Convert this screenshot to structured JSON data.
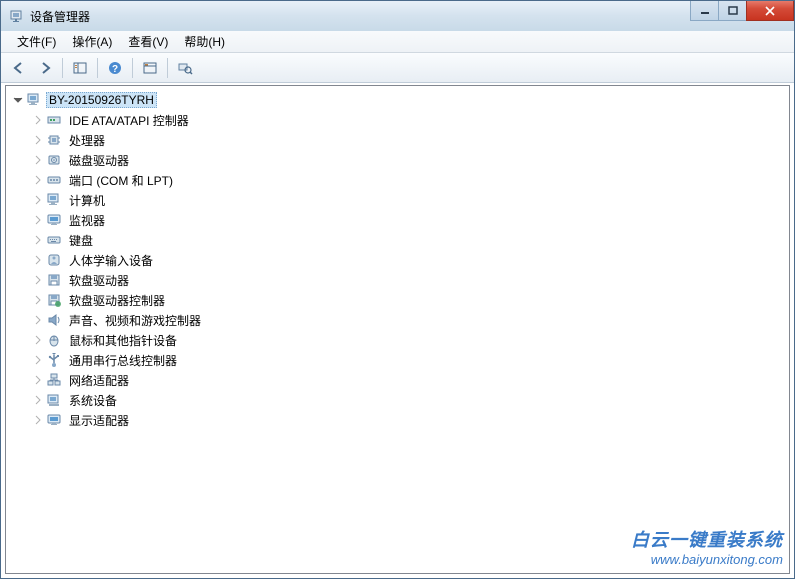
{
  "window": {
    "title": "设备管理器"
  },
  "menu": {
    "file": "文件(F)",
    "action": "操作(A)",
    "view": "查看(V)",
    "help": "帮助(H)"
  },
  "tree": {
    "root": "BY-20150926TYRH",
    "items": [
      {
        "label": "IDE ATA/ATAPI 控制器",
        "icon": "ide"
      },
      {
        "label": "处理器",
        "icon": "cpu"
      },
      {
        "label": "磁盘驱动器",
        "icon": "disk"
      },
      {
        "label": "端口 (COM 和 LPT)",
        "icon": "port"
      },
      {
        "label": "计算机",
        "icon": "computer"
      },
      {
        "label": "监视器",
        "icon": "monitor"
      },
      {
        "label": "键盘",
        "icon": "keyboard"
      },
      {
        "label": "人体学输入设备",
        "icon": "hid"
      },
      {
        "label": "软盘驱动器",
        "icon": "floppy"
      },
      {
        "label": "软盘驱动器控制器",
        "icon": "floppyctrl"
      },
      {
        "label": "声音、视频和游戏控制器",
        "icon": "sound"
      },
      {
        "label": "鼠标和其他指针设备",
        "icon": "mouse"
      },
      {
        "label": "通用串行总线控制器",
        "icon": "usb"
      },
      {
        "label": "网络适配器",
        "icon": "network"
      },
      {
        "label": "系统设备",
        "icon": "system"
      },
      {
        "label": "显示适配器",
        "icon": "display"
      }
    ]
  },
  "watermark": {
    "title": "白云一键重装系统",
    "url": "www.baiyunxitong.com"
  }
}
